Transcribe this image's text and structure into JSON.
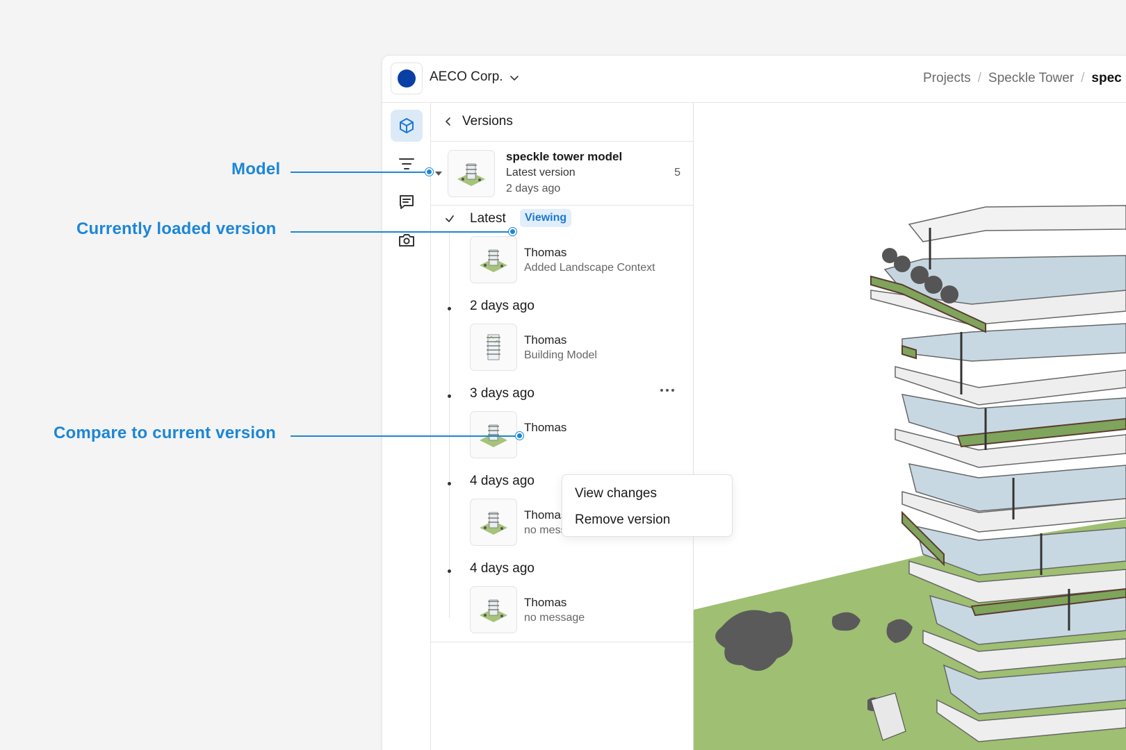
{
  "annotations": {
    "model": "Model",
    "current_version": "Currently loaded version",
    "compare": "Compare to current version",
    "color": "#1c86d8"
  },
  "workspace": {
    "name": "AECO Corp.",
    "logo_color": "#0a3fa6",
    "chevron_icon": "chevron-down-icon"
  },
  "breadcrumb": {
    "items": [
      "Projects",
      "Speckle Tower",
      "spec"
    ],
    "separator": "/"
  },
  "rail": {
    "items": [
      "models-cube-icon",
      "filter-icon",
      "comments-icon",
      "camera-icon"
    ],
    "active_color": "#dceaf8"
  },
  "panel": {
    "title": "Versions",
    "back_icon": "chevron-left-icon"
  },
  "model": {
    "name": "speckle tower model",
    "subtitle": "Latest version",
    "age": "2 days ago",
    "count": "5"
  },
  "versions": [
    {
      "group": "Latest",
      "badge": "Viewing",
      "author": "Thomas",
      "message": "Added Landscape Context"
    },
    {
      "group": "2 days ago",
      "author": "Thomas",
      "message": "Building Model"
    },
    {
      "group": "3 days ago",
      "author": "Thomas",
      "message": ""
    },
    {
      "group": "4 days ago",
      "author": "Thomas",
      "message": "no message"
    },
    {
      "group": "4 days ago",
      "author": "Thomas",
      "message": "no message"
    }
  ],
  "menu": {
    "items": [
      "View changes",
      "Remove version"
    ]
  }
}
